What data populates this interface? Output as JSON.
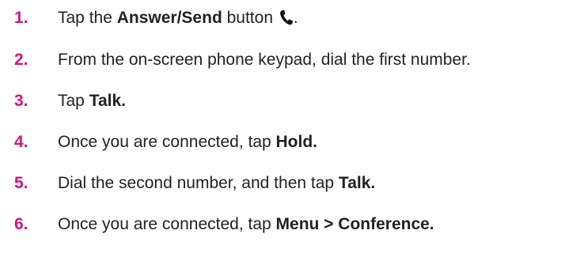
{
  "steps": [
    {
      "number": "1.",
      "text_before": "Tap the ",
      "bold": "Answer/Send",
      "text_after": " button",
      "icon": "phone-handset-icon",
      "trailing": "."
    },
    {
      "number": "2.",
      "text": "From the on-screen phone keypad, dial the first number."
    },
    {
      "number": "3.",
      "text_before": "Tap ",
      "bold": "Talk."
    },
    {
      "number": "4.",
      "text_before": "Once you are connected, tap ",
      "bold": "Hold."
    },
    {
      "number": "5.",
      "text_before": "Dial the second number, and then tap ",
      "bold": "Talk."
    },
    {
      "number": "6.",
      "text_before": "Once you are connected, tap ",
      "bold": "Menu > Conference."
    }
  ],
  "colors": {
    "number": "#d6157a",
    "text": "#222222"
  }
}
